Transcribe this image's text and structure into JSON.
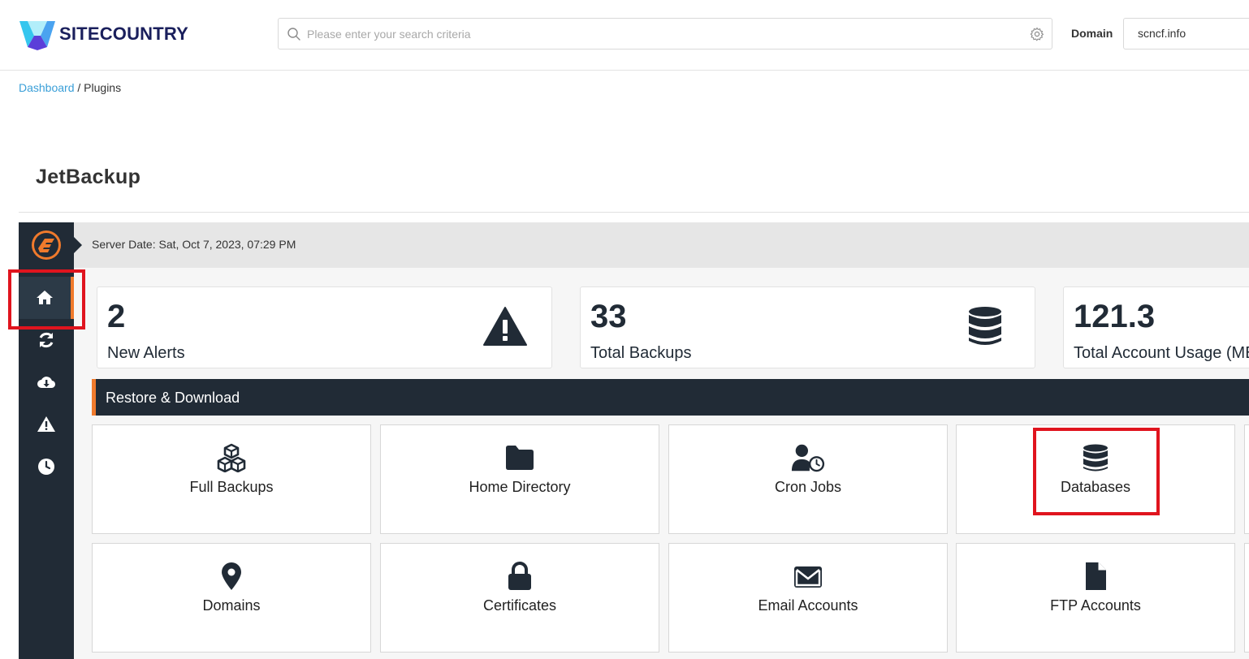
{
  "header": {
    "brand": "SITECOUNTRY",
    "search_placeholder": "Please enter your search criteria",
    "domain_label": "Domain",
    "domain_value": "scncf.info"
  },
  "breadcrumb": {
    "root": "Dashboard",
    "separator": "/",
    "current": "Plugins"
  },
  "page_title": "JetBackup",
  "plugin": {
    "server_date": "Server Date: Sat, Oct 7, 2023, 07:29 PM",
    "sidebar_icons": [
      "home-icon",
      "sync-icon",
      "cloud-download-icon",
      "warning-icon",
      "clock-icon"
    ],
    "stats": [
      {
        "value": "2",
        "label": "New Alerts",
        "icon": "warning-icon"
      },
      {
        "value": "33",
        "label": "Total Backups",
        "icon": "database-icon"
      },
      {
        "value": "121.3",
        "label": "Total Account Usage (MB)",
        "icon": ""
      }
    ],
    "section_title": "Restore & Download",
    "tiles": [
      {
        "label": "Full Backups",
        "icon": "cubes-icon"
      },
      {
        "label": "Home Directory",
        "icon": "folder-icon"
      },
      {
        "label": "Cron Jobs",
        "icon": "user-clock-icon"
      },
      {
        "label": "Databases",
        "icon": "database-icon"
      },
      {
        "label": "Domains",
        "icon": "map-marker-icon"
      },
      {
        "label": "Certificates",
        "icon": "lock-icon"
      },
      {
        "label": "Email Accounts",
        "icon": "envelope-icon"
      },
      {
        "label": "FTP Accounts",
        "icon": "file-icon"
      }
    ]
  },
  "colors": {
    "sidebar_bg": "#212b36",
    "accent_orange": "#f07a2c",
    "link_blue": "#3a9fd8",
    "highlight_red": "#e0141e"
  }
}
